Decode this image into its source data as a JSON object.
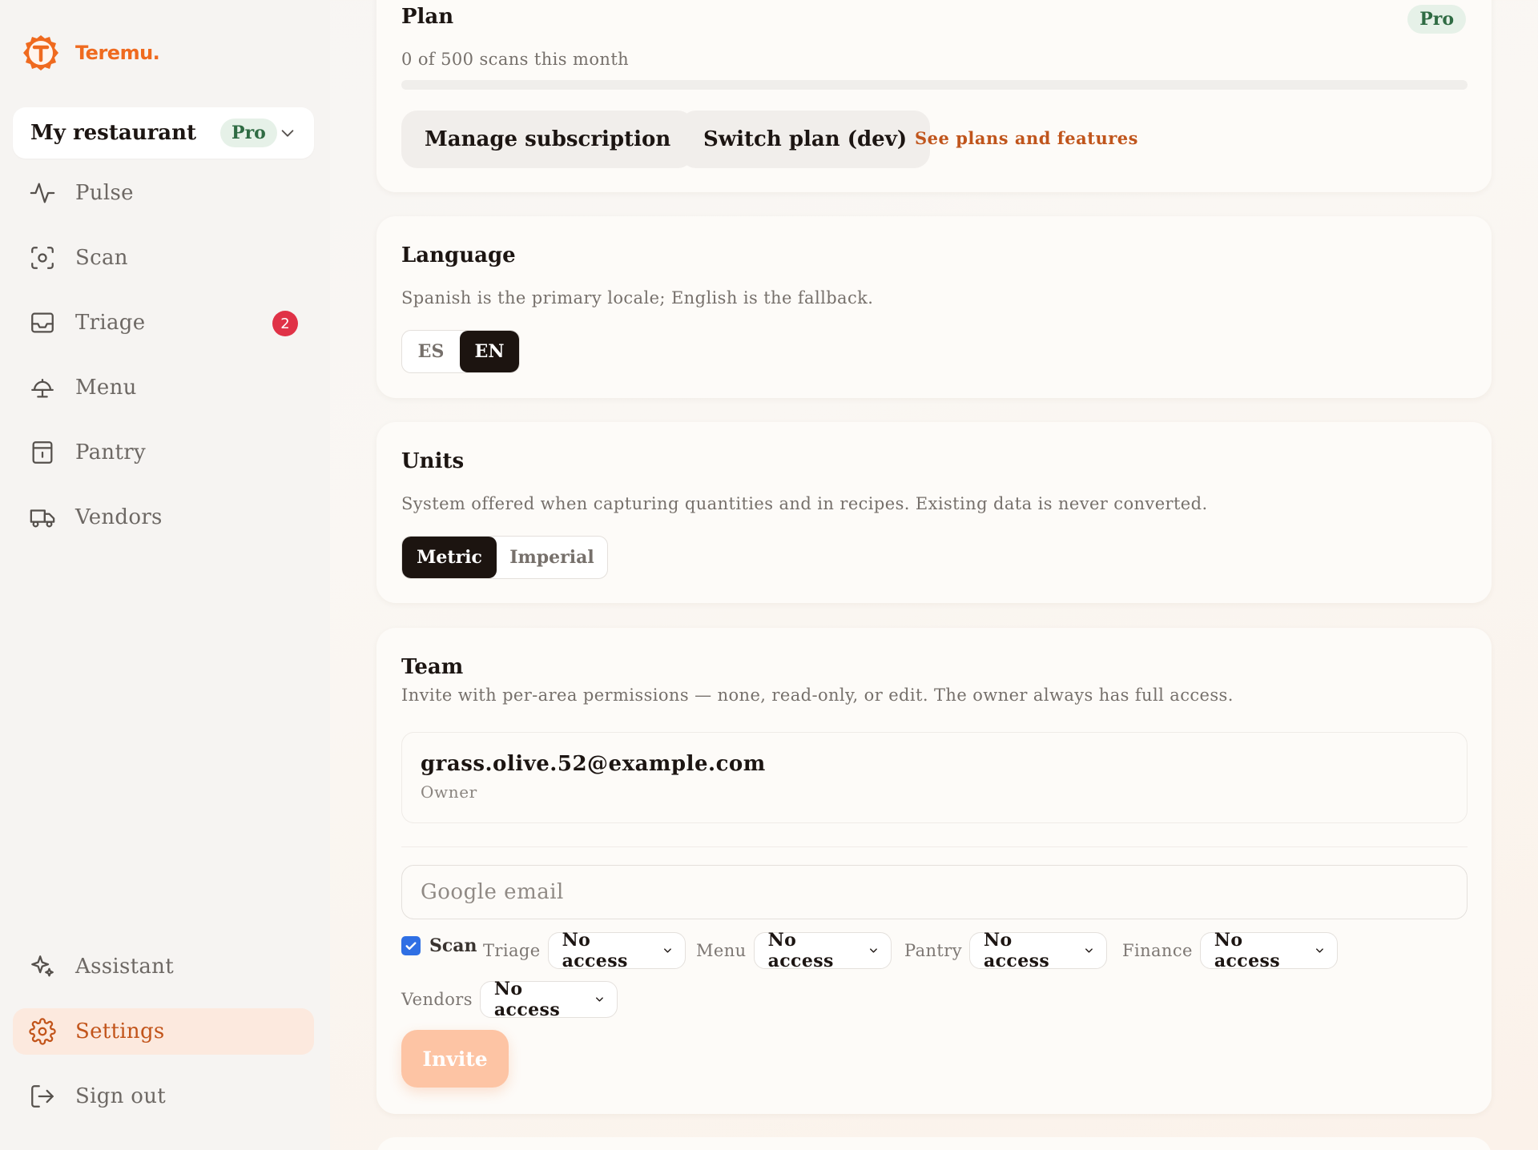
{
  "brand": {
    "name": "Teremu."
  },
  "workspace": {
    "name": "My restaurant",
    "plan_badge": "Pro"
  },
  "nav": {
    "pulse": "Pulse",
    "scan": "Scan",
    "triage": "Triage",
    "triage_badge": "2",
    "menu": "Menu",
    "pantry": "Pantry",
    "vendors": "Vendors"
  },
  "bottom_nav": {
    "assistant": "Assistant",
    "settings": "Settings",
    "sign_out": "Sign out"
  },
  "plan": {
    "title": "Plan",
    "badge": "Pro",
    "usage": "0 of 500 scans this month",
    "scans_used": 0,
    "scans_limit": 500,
    "manage_label": "Manage subscription",
    "switch_label": "Switch plan (dev)",
    "plans_link": "See plans and features"
  },
  "language": {
    "title": "Language",
    "description": "Spanish is the primary locale; English is the fallback.",
    "options": [
      "ES",
      "EN"
    ],
    "selected": "EN"
  },
  "units": {
    "title": "Units",
    "description": "System offered when capturing quantities and in recipes. Existing data is never converted.",
    "options": [
      "Metric",
      "Imperial"
    ],
    "selected": "Metric"
  },
  "team": {
    "title": "Team",
    "description": "Invite with per-area permissions — none, read-only, or edit. The owner always has full access.",
    "members": [
      {
        "email": "grass.olive.52@example.com",
        "role": "Owner"
      }
    ],
    "invite": {
      "email_placeholder": "Google email",
      "scan_label": "Scan",
      "scan_checked": true,
      "permissions": [
        {
          "area": "Triage",
          "value": "No access"
        },
        {
          "area": "Menu",
          "value": "No access"
        },
        {
          "area": "Pantry",
          "value": "No access"
        },
        {
          "area": "Finance",
          "value": "No access"
        },
        {
          "area": "Vendors",
          "value": "No access"
        }
      ],
      "invite_label": "Invite"
    }
  },
  "colors": {
    "accent": "#ef6a1f",
    "accent_text": "#c0551c",
    "pro_badge_bg": "#e6f1e8",
    "pro_badge_text": "#2f6b43",
    "badge_red": "#e03247",
    "dark_segment": "#1c1410"
  }
}
